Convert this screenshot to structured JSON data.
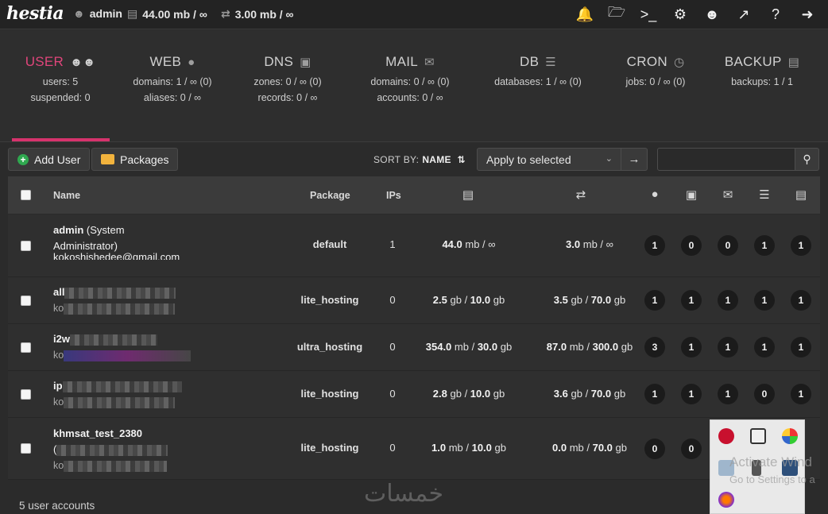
{
  "brand": "hestia",
  "topbar": {
    "user": "admin",
    "disk": "44.00 mb / ∞",
    "bandwidth": "3.00 mb / ∞",
    "icons": [
      "bell-icon",
      "folder-icon",
      "terminal-icon",
      "gear-icon",
      "user-circle-icon",
      "chart-icon",
      "help-icon",
      "logout-icon"
    ]
  },
  "stats": [
    {
      "title": "USER",
      "icon": "users-icon",
      "line1": "users: 5",
      "line2": "suspended: 0",
      "active": true
    },
    {
      "title": "WEB",
      "icon": "globe-icon",
      "line1": "domains: 1 / ∞ (0)",
      "line2": "aliases: 0 / ∞"
    },
    {
      "title": "DNS",
      "icon": "book-icon",
      "line1": "zones: 0 / ∞ (0)",
      "line2": "records: 0 / ∞"
    },
    {
      "title": "MAIL",
      "icon": "mail-icon",
      "line1": "domains: 0 / ∞ (0)",
      "line2": "accounts: 0 / ∞"
    },
    {
      "title": "DB",
      "icon": "database-icon",
      "line1": "databases: 1 / ∞ (0)",
      "line2": ""
    },
    {
      "title": "CRON",
      "icon": "clock-icon",
      "line1": "jobs: 0 / ∞ (0)",
      "line2": ""
    },
    {
      "title": "BACKUP",
      "icon": "file-archive-icon",
      "line1": "backups: 1 / 1",
      "line2": ""
    }
  ],
  "toolbar": {
    "add_user": "Add User",
    "packages": "Packages",
    "sort_label": "SORT BY:",
    "sort_value": "NAME",
    "bulk_select": "Apply to selected",
    "search_placeholder": ""
  },
  "table": {
    "headers": {
      "name": "Name",
      "package": "Package",
      "ips": "IPs"
    },
    "rows": [
      {
        "name": "admin",
        "name_extra": "(System",
        "line2": "Administrator)",
        "email": "kokoshishedee@gmail.com",
        "package": "default",
        "ips": "1",
        "disk_used": "44.0",
        "disk_unit": "mb",
        "disk_limit": "∞",
        "disk_limit_unit": "",
        "bw_used": "3.0",
        "bw_unit": "mb",
        "bw_limit": "∞",
        "bw_limit_unit": "",
        "counts": [
          "1",
          "0",
          "0",
          "1",
          "1"
        ]
      },
      {
        "name": "all",
        "name_extra": "",
        "line2": "",
        "email": "ko",
        "package": "lite_hosting",
        "ips": "0",
        "disk_used": "2.5",
        "disk_unit": "gb",
        "disk_limit": "10.0",
        "disk_limit_unit": "gb",
        "bw_used": "3.5",
        "bw_unit": "gb",
        "bw_limit": "70.0",
        "bw_limit_unit": "gb",
        "counts": [
          "1",
          "1",
          "1",
          "1",
          "1"
        ]
      },
      {
        "name": "i2w",
        "name_extra": "",
        "line2": "",
        "email": "ko",
        "package": "ultra_hosting",
        "ips": "0",
        "disk_used": "354.0",
        "disk_unit": "mb",
        "disk_limit": "30.0",
        "disk_limit_unit": "gb",
        "bw_used": "87.0",
        "bw_unit": "mb",
        "bw_limit": "300.0",
        "bw_limit_unit": "gb",
        "counts": [
          "3",
          "1",
          "1",
          "1",
          "1"
        ]
      },
      {
        "name": "ip",
        "name_extra": "",
        "line2": "",
        "email": "ko",
        "package": "lite_hosting",
        "ips": "0",
        "disk_used": "2.8",
        "disk_unit": "gb",
        "disk_limit": "10.0",
        "disk_limit_unit": "gb",
        "bw_used": "3.6",
        "bw_unit": "gb",
        "bw_limit": "70.0",
        "bw_limit_unit": "gb",
        "counts": [
          "1",
          "1",
          "1",
          "0",
          "1"
        ]
      },
      {
        "name": "khmsat_test_2380",
        "name_extra": "",
        "line2": "(",
        "email": "ko",
        "package": "lite_hosting",
        "ips": "0",
        "disk_used": "1.0",
        "disk_unit": "mb",
        "disk_limit": "10.0",
        "disk_limit_unit": "gb",
        "bw_used": "0.0",
        "bw_unit": "mb",
        "bw_limit": "70.0",
        "bw_limit_unit": "gb",
        "counts": [
          "0",
          "0",
          "",
          "",
          ""
        ]
      }
    ]
  },
  "footer": "5 user accounts",
  "watermark": "خمسات",
  "overlay": {
    "activate_line1": "Activate Wind",
    "activate_line2": "Go to Settings to a"
  }
}
